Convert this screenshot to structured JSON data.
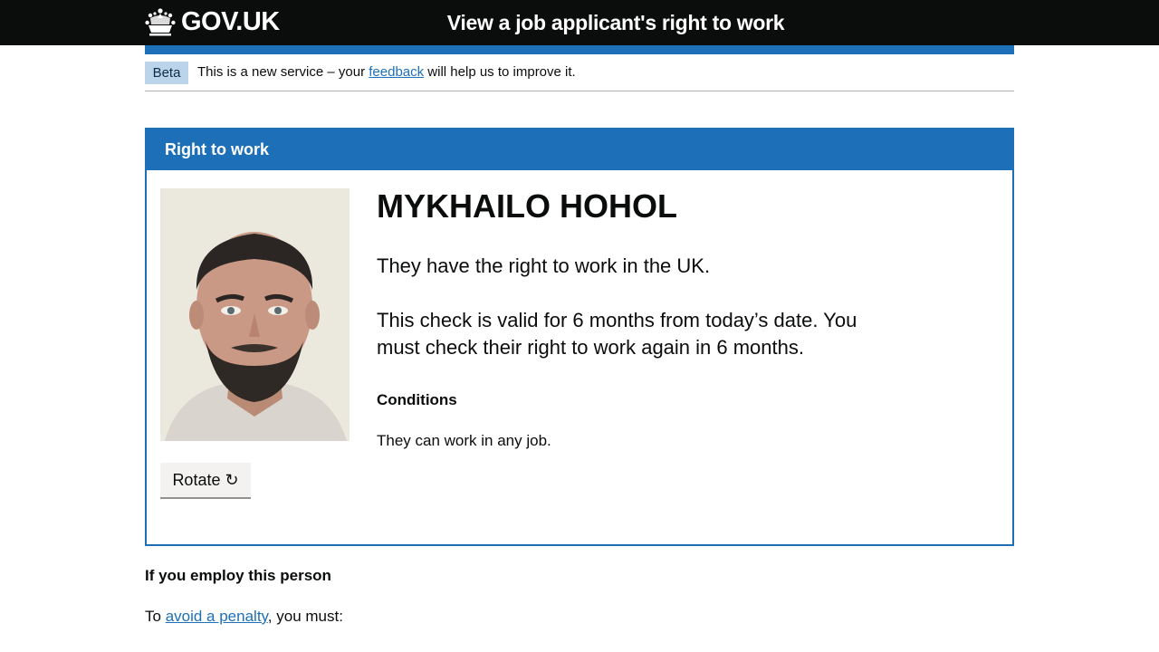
{
  "header": {
    "logo_text": "GOV.UK",
    "logo_icon": "crown-icon",
    "service_name": "View a job applicant's right to work"
  },
  "phase_banner": {
    "tag": "Beta",
    "text_before": "This is a new service – your ",
    "link": "feedback",
    "text_after": " will help us to improve it."
  },
  "card": {
    "title": "Right to work",
    "photo_alt": "Photo of the job applicant",
    "rotate_button": "Rotate ↻",
    "name": "MYKHAILO HOHOL",
    "status": "They have the right to work in the UK.",
    "validity": "This check is valid for 6 months from today’s date. You must check their right to work again in 6 months.",
    "conditions_heading": "Conditions",
    "conditions_text": "They can work in any job."
  },
  "employ": {
    "heading": "If you employ this person",
    "text_before": "To ",
    "link": "avoid a penalty",
    "text_after": ", you must:"
  },
  "colors": {
    "header_bg": "#0b0c0c",
    "brand_blue": "#1d70b8",
    "link": "#1d70b8",
    "beta_tag_bg": "#bbd4ea",
    "button_bg": "#f3f2f1"
  }
}
